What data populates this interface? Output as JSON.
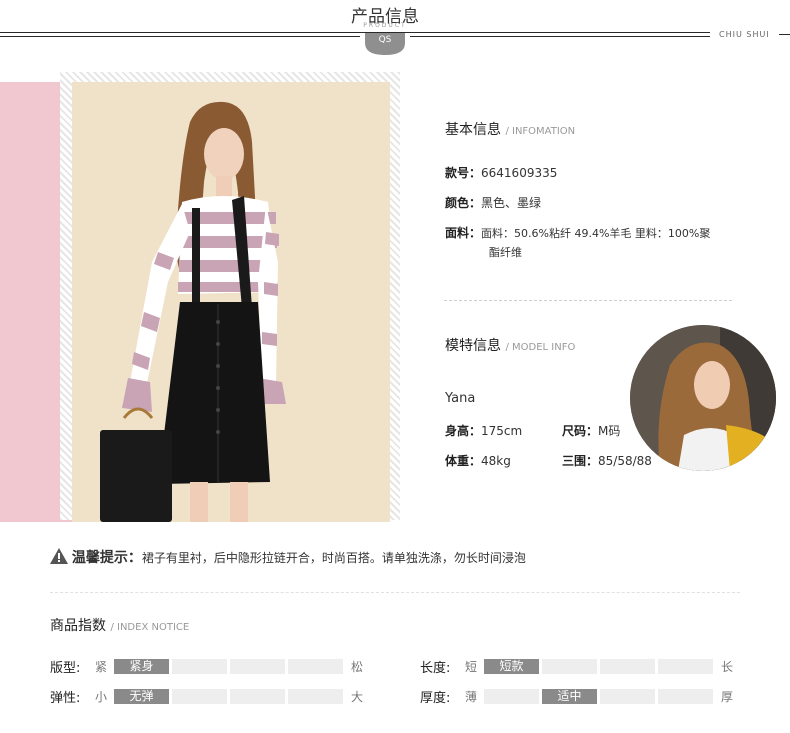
{
  "header": {
    "title": "产品信息",
    "subtitle": "PRODUCT",
    "brand": "CHIU SHUI",
    "badge": "QS"
  },
  "basic": {
    "title": "基本信息",
    "title_en": "/ INFOMATION",
    "items": [
      {
        "label": "款号：",
        "value": "6641609335"
      },
      {
        "label": "颜色：",
        "value": "黑色、墨绿"
      },
      {
        "label": "面料：",
        "value": "面料：50.6%粘纤 49.4%羊毛 里料：100%聚",
        "value2": "酯纤维"
      }
    ]
  },
  "model": {
    "title": "模特信息",
    "title_en": "/ MODEL INFO",
    "name": "Yana",
    "height_label": "身高：",
    "height": "175cm",
    "size_label": "尺码：",
    "size": "M码",
    "weight_label": "体重：",
    "weight": "48kg",
    "measure_label": "三围：",
    "measure": "85/58/88"
  },
  "notice": {
    "title": "温馨提示：",
    "text": "裙子有里衬，后中隐形拉链开合，时尚百搭。请单独洗涤，勿长时间浸泡"
  },
  "index": {
    "title": "商品指数",
    "title_en": "/ INDEX NOTICE",
    "scales": [
      {
        "label": "版型:",
        "left": "紧",
        "right": "松",
        "segments": [
          "紧身",
          "",
          "",
          "",
          ""
        ],
        "active": 0
      },
      {
        "label": "长度:",
        "left": "短",
        "right": "长",
        "segments": [
          "短款",
          "",
          "",
          "",
          ""
        ],
        "active": 0
      },
      {
        "label": "弹性:",
        "left": "小",
        "right": "大",
        "segments": [
          "无弹",
          "",
          "",
          "",
          ""
        ],
        "active": 0
      },
      {
        "label": "厚度:",
        "left": "薄",
        "right": "厚",
        "segments": [
          "",
          "适中",
          "",
          "",
          ""
        ],
        "active": 1
      }
    ]
  }
}
